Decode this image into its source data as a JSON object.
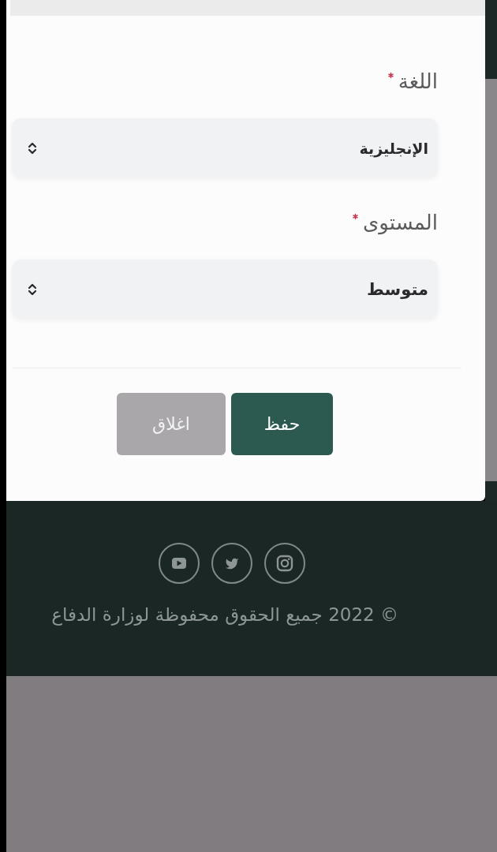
{
  "dialog": {
    "fields": [
      {
        "label": "اللغة",
        "required": true,
        "value": "الإنجليزية"
      },
      {
        "label": "المستوى",
        "required": true,
        "value": "متوسط"
      }
    ],
    "buttons": [
      {
        "label": "حفظ",
        "kind": "primary"
      },
      {
        "label": "اغلاق",
        "kind": "secondary"
      }
    ]
  },
  "footer": {
    "social_links": [
      {
        "kind": "instagram"
      },
      {
        "kind": "twitter"
      },
      {
        "kind": "youtube"
      }
    ],
    "copyright": "© 2022 جميع الحقوق محفوظة لوزارة الدفاع"
  }
}
